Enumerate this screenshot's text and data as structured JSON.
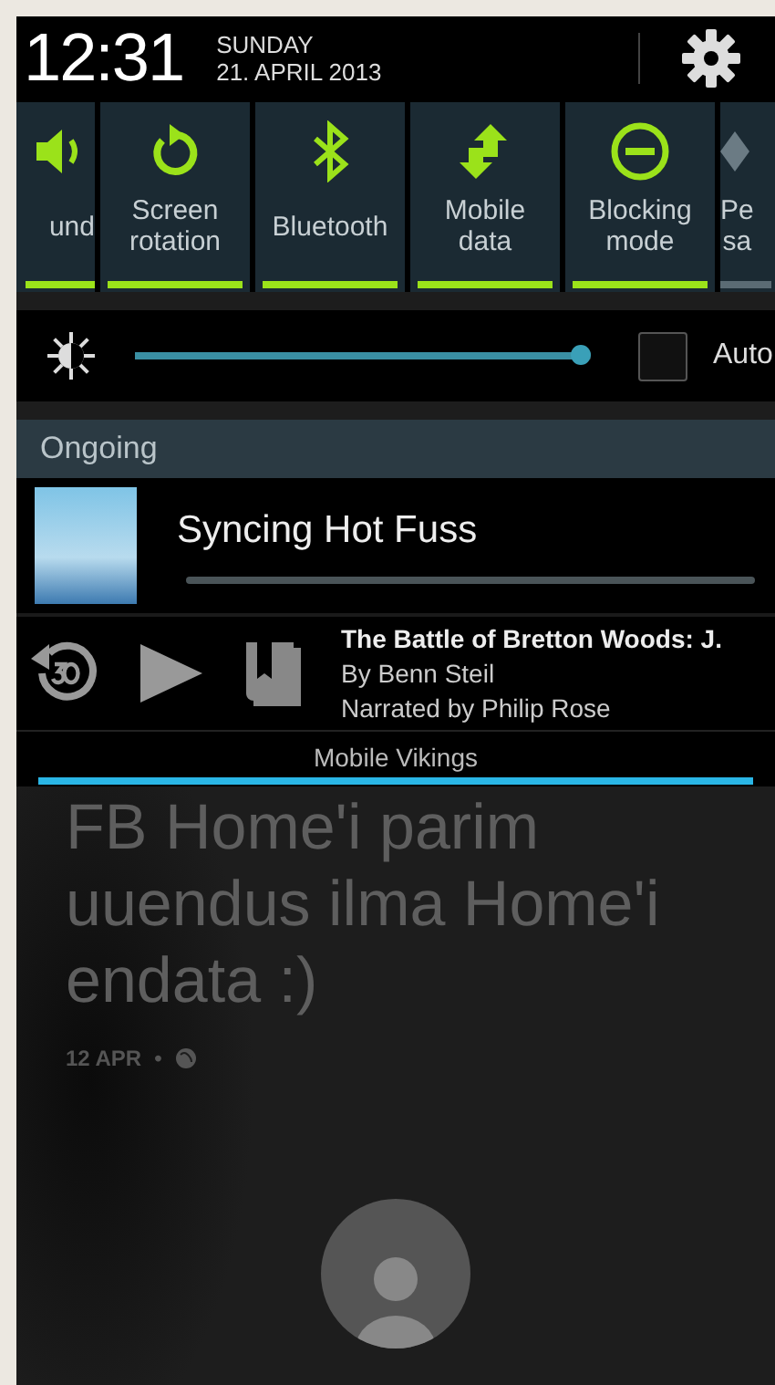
{
  "status_header": {
    "time": "12:31",
    "day": "SUNDAY",
    "date": "21. APRIL 2013"
  },
  "quick_settings": [
    {
      "kind": "sound",
      "label": "und",
      "on": true
    },
    {
      "kind": "rotation",
      "label": "Screen\nrotation",
      "on": true
    },
    {
      "kind": "bluetooth",
      "label": "Bluetooth",
      "on": true
    },
    {
      "kind": "mobile_data",
      "label": "Mobile\ndata",
      "on": true
    },
    {
      "kind": "blocking",
      "label": "Blocking\nmode",
      "on": true
    },
    {
      "kind": "power",
      "label": "Pe\nsa",
      "on": false
    }
  ],
  "brightness": {
    "level": 0.98,
    "auto_checked": false,
    "auto_label": "Auto"
  },
  "section_header": "Ongoing",
  "notifications": [
    {
      "kind": "sync",
      "title": "Syncing Hot Fuss"
    },
    {
      "kind": "audiobook",
      "title": "The Battle of Bretton Woods: J.",
      "author": "By Benn Steil",
      "narrator": "Narrated by Philip Rose"
    }
  ],
  "carrier": "Mobile Vikings",
  "background_post": {
    "lines": [
      "FB Home'i parim",
      "uuendus ilma Home'i",
      "endata :)"
    ],
    "date": "12 APR",
    "separator": "•"
  }
}
